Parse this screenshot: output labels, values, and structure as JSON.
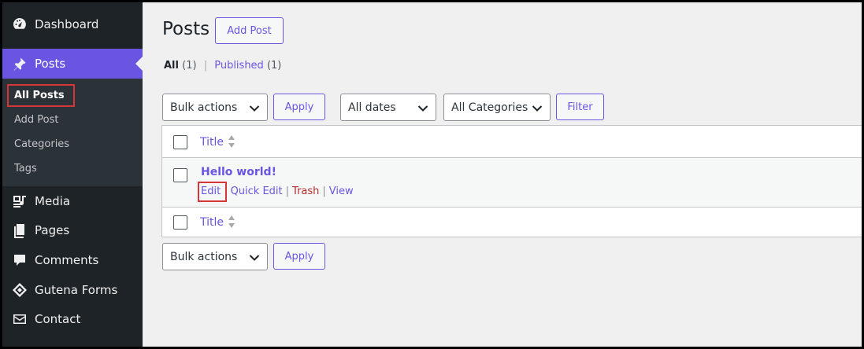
{
  "sidebar": {
    "items": [
      {
        "label": "Dashboard",
        "icon": "dashboard-icon"
      },
      {
        "label": "Posts",
        "icon": "pin-icon",
        "active": true
      },
      {
        "label": "Media",
        "icon": "media-icon"
      },
      {
        "label": "Pages",
        "icon": "pages-icon"
      },
      {
        "label": "Comments",
        "icon": "comment-icon"
      },
      {
        "label": "Gutena Forms",
        "icon": "gutena-icon"
      },
      {
        "label": "Contact",
        "icon": "mail-icon"
      }
    ],
    "submenu": [
      "All Posts",
      "Add Post",
      "Categories",
      "Tags"
    ],
    "accent_color": "#6a55e3"
  },
  "header": {
    "title": "Posts",
    "add_button": "Add Post"
  },
  "views": {
    "all": "All",
    "all_count": "(1)",
    "separator": "|",
    "published": "Published",
    "published_count": "(1)"
  },
  "filters": {
    "bulk_actions": "Bulk actions",
    "apply": "Apply",
    "dates": "All dates",
    "categories": "All Categories",
    "filter": "Filter"
  },
  "table": {
    "column_title": "Title",
    "rows": [
      {
        "title": "Hello world!",
        "actions": {
          "edit": "Edit",
          "quick_edit": "Quick Edit",
          "trash": "Trash",
          "view": "View"
        }
      }
    ],
    "footer_title": "Title"
  },
  "bottom_bar": {
    "bulk_actions": "Bulk actions",
    "apply": "Apply"
  }
}
